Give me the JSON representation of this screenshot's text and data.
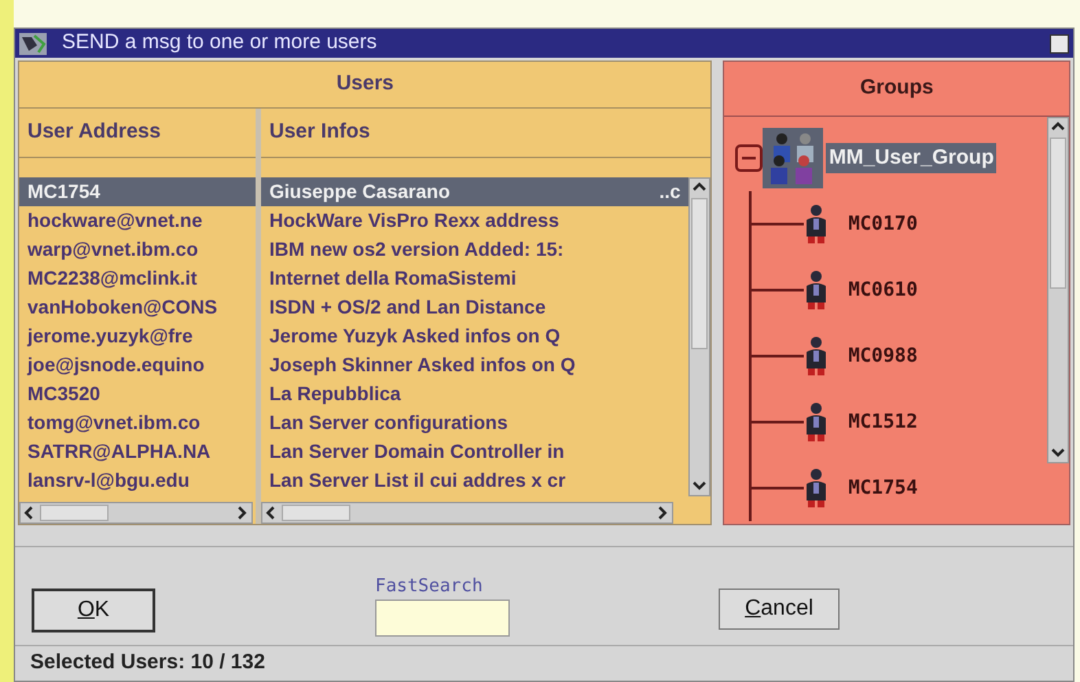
{
  "window": {
    "title": "SEND a msg to one or more users"
  },
  "users": {
    "title": "Users",
    "columns": [
      "User Address",
      "User Infos"
    ],
    "rows": [
      {
        "address": "MC1754",
        "info": "Giuseppe Casarano",
        "info_tail": "..c",
        "selected": true
      },
      {
        "address": "hockware@vnet.ne",
        "info": "HockWare VisPro Rexx address",
        "selected": false
      },
      {
        "address": "warp@vnet.ibm.co",
        "info": "IBM new os2 version  Added: 15:",
        "selected": false
      },
      {
        "address": "MC2238@mclink.it",
        "info": "Internet della RomaSistemi",
        "selected": false
      },
      {
        "address": "vanHoboken@CONS",
        "info": "ISDN + OS/2 and Lan Distance",
        "selected": false
      },
      {
        "address": "jerome.yuzyk@fre",
        "info": "Jerome Yuzyk Asked infos on Q",
        "selected": false
      },
      {
        "address": "joe@jsnode.equino",
        "info": "Joseph Skinner Asked infos on Q",
        "selected": false
      },
      {
        "address": "MC3520",
        "info": "La Repubblica",
        "selected": false
      },
      {
        "address": "tomg@vnet.ibm.co",
        "info": "Lan Server configurations",
        "selected": false
      },
      {
        "address": "SATRR@ALPHA.NA",
        "info": "Lan Server Domain Controller in",
        "selected": false
      },
      {
        "address": "lansrv-l@bgu.edu",
        "info": "Lan Server List il cui addres x cr",
        "selected": false
      }
    ]
  },
  "groups": {
    "title": "Groups",
    "tree": [
      {
        "label": "MM_User_Group",
        "expanded": true,
        "selected": true,
        "children": [
          {
            "label": "MC0170",
            "selected": false
          },
          {
            "label": "MC0610",
            "selected": false
          },
          {
            "label": "MC0988",
            "selected": false
          },
          {
            "label": "MC1512",
            "selected": false
          },
          {
            "label": "MC1754",
            "selected": false
          }
        ]
      }
    ]
  },
  "buttons": [
    {
      "label": "OK",
      "default": true
    },
    {
      "label": "Cancel",
      "default": false
    }
  ],
  "fast_search": {
    "label": "FastSearch"
  },
  "status_bar": "Selected Users: 10 / 132"
}
